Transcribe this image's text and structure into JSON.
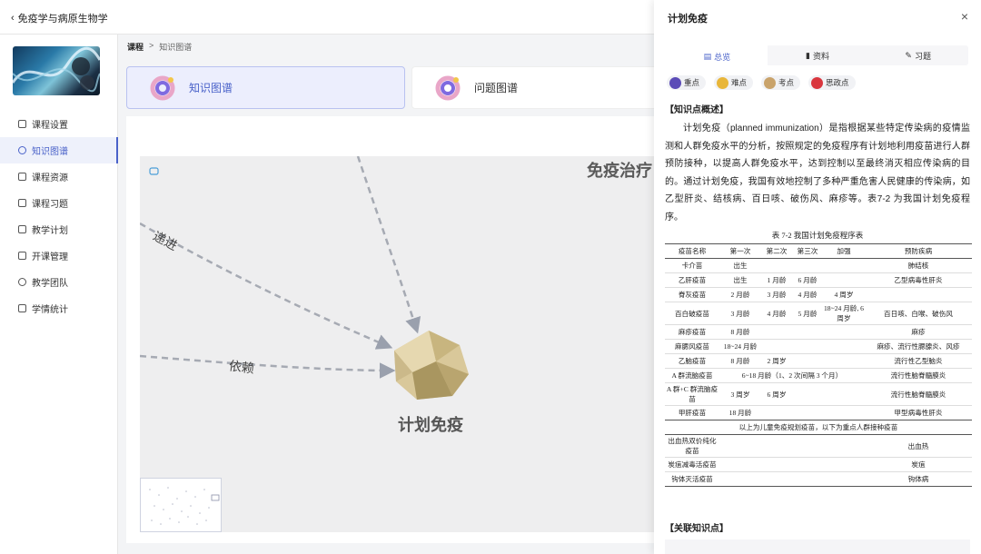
{
  "header": {
    "back_label": "免疫学与病原生物学"
  },
  "breadcrumb": {
    "root": "课程",
    "sep": ">",
    "current": "知识图谱"
  },
  "sidebar": {
    "items": [
      {
        "label": "课程设置",
        "icon": "square-icon"
      },
      {
        "label": "知识图谱",
        "icon": "graph-icon",
        "active": true
      },
      {
        "label": "课程资源",
        "icon": "folder-icon"
      },
      {
        "label": "课程习题",
        "icon": "list-icon"
      },
      {
        "label": "教学计划",
        "icon": "calendar-icon"
      },
      {
        "label": "开课管理",
        "icon": "book-icon"
      },
      {
        "label": "教学团队",
        "icon": "team-icon"
      },
      {
        "label": "学情统计",
        "icon": "chart-icon"
      }
    ]
  },
  "cards": {
    "knowledge": "知识图谱",
    "question": "问题图谱"
  },
  "graph": {
    "center_label": "计划免疫",
    "top_node_label": "免疫治疗",
    "edge_labels": {
      "progress": "递进",
      "depend": "依赖"
    }
  },
  "panel": {
    "title": "计划免疫",
    "close": "×",
    "tabs": [
      "总览",
      "资料",
      "习题"
    ],
    "tags": [
      {
        "label": "重点",
        "color": "#5b4bb7"
      },
      {
        "label": "难点",
        "color": "#e8b63a"
      },
      {
        "label": "考点",
        "color": "#c9a36b"
      },
      {
        "label": "思政点",
        "color": "#d9363e"
      }
    ],
    "overview_title": "【知识点概述】",
    "overview_text": "计划免疫（planned immunization）是指根据某些特定传染病的疫情监测和人群免疫水平的分析，按照规定的免疫程序有计划地利用疫苗进行人群预防接种，以提高人群免疫水平，达到控制以至最终消灭相应传染病的目的。通过计划免疫，我国有效地控制了多种严重危害人民健康的传染病，如乙型肝炎、结核病、百日咳、破伤风、麻疹等。表7-2 为我国计划免疫程序。",
    "table_caption": "表 7-2  我国计划免疫程序表",
    "table_header": [
      "疫苗名称",
      "第一次",
      "第二次",
      "第三次",
      "加强",
      "预防疾病"
    ],
    "table_rows": [
      [
        "卡介苗",
        "出生",
        "",
        "",
        "",
        "肺结核"
      ],
      [
        "乙肝疫苗",
        "出生",
        "1 月龄",
        "6 月龄",
        "",
        "乙型病毒性肝炎"
      ],
      [
        "脊灰疫苗",
        "2 月龄",
        "3 月龄",
        "4 月龄",
        "4 周岁",
        ""
      ],
      [
        "百白破疫苗",
        "3 月龄",
        "4 月龄",
        "5 月龄",
        "18~24 月龄, 6 周岁",
        "百日咳、白喉、破伤风"
      ],
      [
        "麻疹疫苗",
        "8 月龄",
        "",
        "",
        "",
        "麻疹"
      ],
      [
        "麻腮风疫苗",
        "18~24 月龄",
        "",
        "",
        "",
        "麻疹、流行性腮腺炎、风疹"
      ],
      [
        "乙脑疫苗",
        "8 月龄",
        "2 周岁",
        "",
        "",
        "流行性乙型脑炎"
      ],
      [
        "A 群流脑疫苗",
        "6~18 月龄（1、2 次间隔 3 个月）",
        "",
        "",
        "",
        "流行性脑脊髓膜炎"
      ],
      [
        "A 群+C 群流脑疫苗",
        "3 周岁",
        "6 周岁",
        "",
        "",
        "流行性脑脊髓膜炎"
      ],
      [
        "甲肝疫苗",
        "18 月龄",
        "",
        "",
        "",
        "甲型病毒性肝炎"
      ]
    ],
    "table_note": "以上为儿童免疫规划疫苗，以下为重点人群接种疫苗",
    "table_rows2": [
      [
        "出血热双价纯化疫苗",
        "",
        "",
        "",
        "",
        "出血热"
      ],
      [
        "炭疽减毒活疫苗",
        "",
        "",
        "",
        "",
        "炭疽"
      ],
      [
        "钩体灭活疫苗",
        "",
        "",
        "",
        "",
        "钩体病"
      ]
    ],
    "related_title": "【关联知识点】"
  }
}
